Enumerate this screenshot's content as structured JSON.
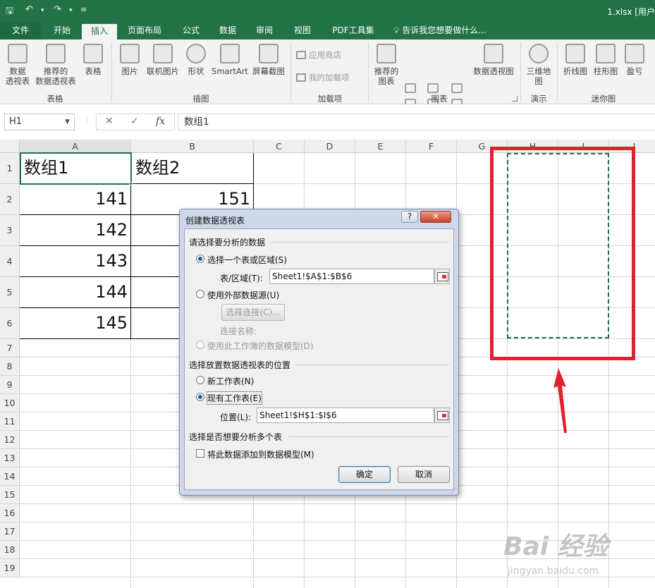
{
  "app": {
    "file_title": "1.xlsx [用户",
    "qat": {
      "save_icon": "save-icon",
      "undo_icon": "undo-icon",
      "redo_icon": "redo-icon",
      "customize_icon": "customize-qat-icon"
    }
  },
  "tabs": [
    {
      "label": "文件"
    },
    {
      "label": "开始"
    },
    {
      "label": "插入"
    },
    {
      "label": "页面布局"
    },
    {
      "label": "公式"
    },
    {
      "label": "数据"
    },
    {
      "label": "审阅"
    },
    {
      "label": "视图"
    },
    {
      "label": "PDF工具集"
    }
  ],
  "tell_me": "告诉我您想要做什么...",
  "ribbon": {
    "pivot_table": "数据\n透视表",
    "recommended_pivot": "推荐的\n数据透视表",
    "table": "表格",
    "group_tables": "表格",
    "picture": "图片",
    "online_picture": "联机图片",
    "shapes": "形状",
    "smartart": "SmartArt",
    "screenshot": "屏幕截图",
    "group_illustrations": "插图",
    "store": "应用商店",
    "my_addins": "我的加载项",
    "group_addins": "加载项",
    "recommended_charts": "推荐的\n图表",
    "pivot_chart": "数据透视图",
    "group_charts": "图表",
    "map_3d": "三维地\n图",
    "group_tours": "演示",
    "spark_line": "折线图",
    "spark_column": "柱形图",
    "spark_winloss": "盈亏",
    "group_sparklines": "迷你图"
  },
  "formula_bar": {
    "name_box": "H1",
    "cancel_glyph": "✕",
    "enter_glyph": "✓",
    "fx_label": "fx",
    "content": "数组1"
  },
  "sheet": {
    "columns": [
      "A",
      "B",
      "C",
      "D",
      "E",
      "F",
      "G",
      "H",
      "I",
      "J"
    ],
    "rows": [
      "1",
      "2",
      "3",
      "4",
      "5",
      "6",
      "7",
      "8",
      "9",
      "10",
      "11",
      "12",
      "13",
      "14",
      "15",
      "16",
      "17",
      "18",
      "19"
    ],
    "headers": {
      "A1": "数组1",
      "B1": "数组2"
    },
    "col_a": [
      "141",
      "142",
      "143",
      "144",
      "145"
    ],
    "col_b": [
      "151"
    ]
  },
  "dialog": {
    "title": "创建数据透视表",
    "help": "?",
    "close": "✕",
    "section_data": "请选择要分析的数据",
    "opt_table_range": "选择一个表或区域(S)",
    "label_table_range": "表/区域(T):",
    "value_table_range": "Sheet1!$A$1:$B$6",
    "opt_external": "使用外部数据源(U)",
    "btn_choose_connection": "选择连接(C)...",
    "label_connection_name": "连接名称:",
    "opt_data_model": "使用此工作簿的数据模型(D)",
    "section_location": "选择放置数据透视表的位置",
    "opt_new_sheet": "新工作表(N)",
    "opt_existing_sheet": "现有工作表(E)",
    "label_location": "位置(L):",
    "value_location": "Sheet1!$H$1:$I$6",
    "section_multi": "选择是否想要分析多个表",
    "chk_add_to_model": "将此数据添加到数据模型(M)",
    "btn_ok": "确定",
    "btn_cancel": "取消"
  },
  "annotation": {
    "box_color": "#e2212f",
    "watermark_brand": "Bai 经验",
    "watermark_url": "jingyan.baidu.com"
  },
  "colors": {
    "excel_green": "#217346",
    "dialog_frame": "#cdd9ea"
  }
}
